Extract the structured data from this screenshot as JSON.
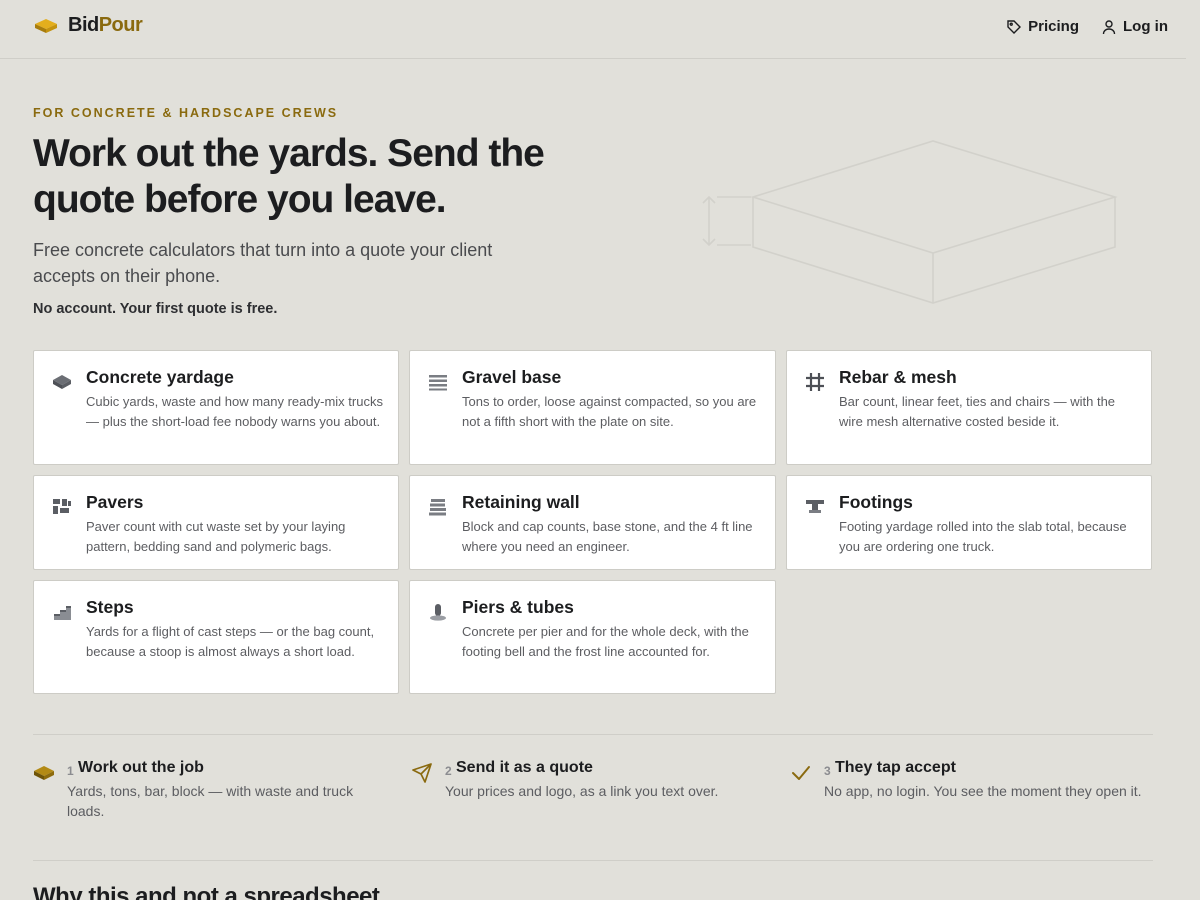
{
  "brand": {
    "bid": "Bid",
    "pour": "Pour"
  },
  "nav": {
    "pricing": "Pricing",
    "login": "Log in"
  },
  "hero": {
    "eyebrow": "FOR CONCRETE & HARDSCAPE CREWS",
    "headline": "Work out the yards. Send the quote before you leave.",
    "subhead": "Free concrete calculators that turn into a quote your client accepts on their phone.",
    "note": "No account. Your first quote is free."
  },
  "calculators": [
    {
      "icon": "slab-icon",
      "title": "Concrete yardage",
      "desc": "Cubic yards, waste and how many ready-mix trucks — plus the short-load fee nobody warns you about."
    },
    {
      "icon": "layers-icon",
      "title": "Gravel base",
      "desc": "Tons to order, loose against compacted, so you are not a fifth short with the plate on site."
    },
    {
      "icon": "grid-icon",
      "title": "Rebar & mesh",
      "desc": "Bar count, linear feet, ties and chairs — with the wire mesh alternative costed beside it."
    },
    {
      "icon": "pavers-icon",
      "title": "Pavers",
      "desc": "Paver count with cut waste set by your laying pattern, bedding sand and polymeric bags."
    },
    {
      "icon": "wall-icon",
      "title": "Retaining wall",
      "desc": "Block and cap counts, base stone, and the 4 ft line where you need an engineer."
    },
    {
      "icon": "footing-icon",
      "title": "Footings",
      "desc": "Footing yardage rolled into the slab total, because you are ordering one truck."
    },
    {
      "icon": "steps-icon",
      "title": "Steps",
      "desc": "Yards for a flight of cast steps — or the bag count, because a stoop is almost always a short load."
    },
    {
      "icon": "pier-icon",
      "title": "Piers & tubes",
      "desc": "Concrete per pier and for the whole deck, with the footing bell and the frost line accounted for."
    }
  ],
  "steps": [
    {
      "icon": "slab-icon",
      "num": "1",
      "title": "Work out the job",
      "desc": "Yards, tons, bar, block — with waste and truck loads."
    },
    {
      "icon": "send-icon",
      "num": "2",
      "title": "Send it as a quote",
      "desc": "Your prices and logo, as a link you text over."
    },
    {
      "icon": "check-icon",
      "num": "3",
      "title": "They tap accept",
      "desc": "No app, no login. You see the moment they open it."
    }
  ],
  "why": "Why this and not a spreadsheet",
  "colors": {
    "accent": "#8a6a0f",
    "brand_gold": "#d9a514",
    "background": "#e1e0da",
    "card": "#ffffff"
  }
}
